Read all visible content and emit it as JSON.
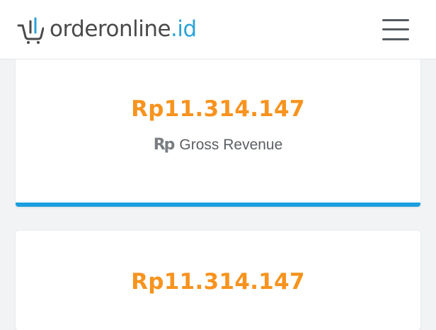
{
  "header": {
    "brand_name": "orderonline",
    "brand_tld": ".id",
    "logo_icon": "shopping-cart-icon",
    "menu_icon": "hamburger-menu-icon",
    "brand_color": "#2aa3d6",
    "text_color": "#4a4a4a"
  },
  "cards": [
    {
      "value": "Rp11.314.147",
      "icon_text": "Rp",
      "label": "Gross Revenue",
      "accent_color": "#1a9ede"
    },
    {
      "value": "Rp11.314.147"
    }
  ],
  "colors": {
    "amount": "#f7931e",
    "background": "#f1f3f5"
  }
}
